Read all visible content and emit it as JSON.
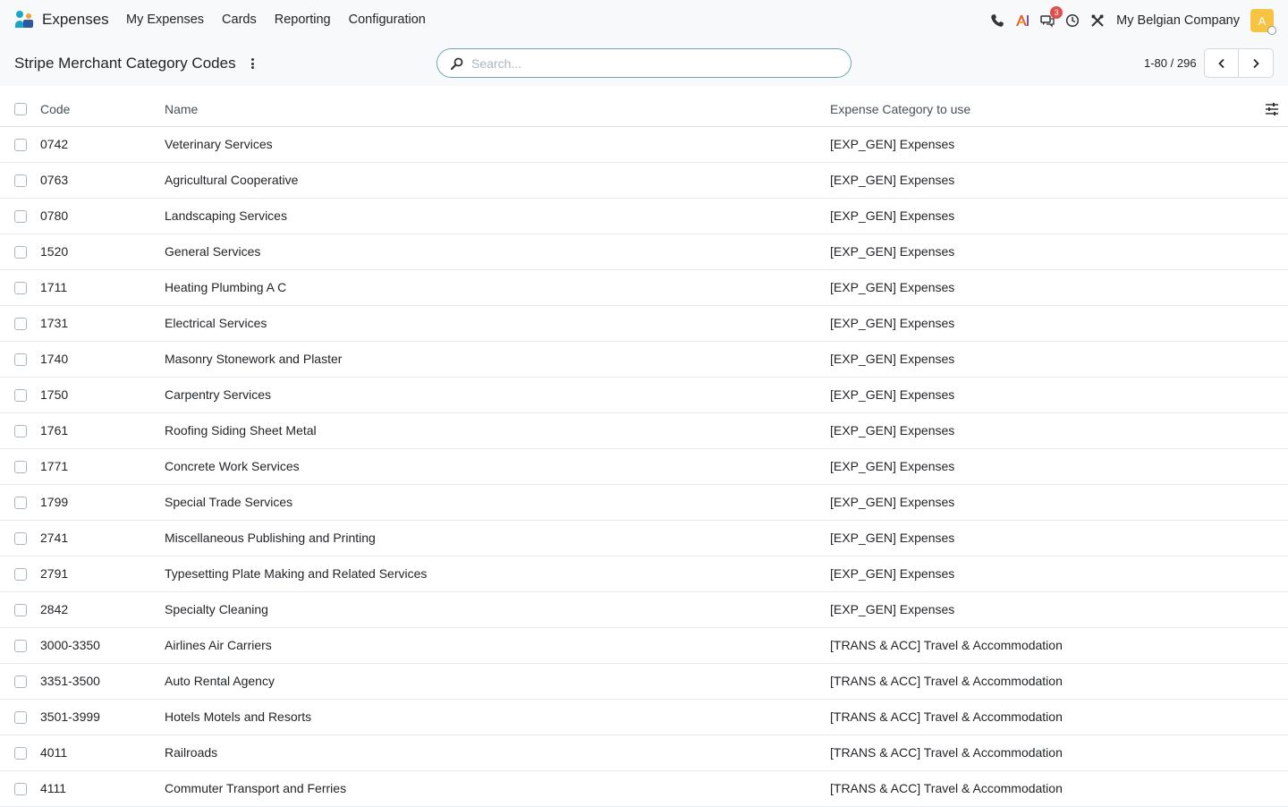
{
  "navbar": {
    "app_name": "Expenses",
    "menu": [
      "My Expenses",
      "Cards",
      "Reporting",
      "Configuration"
    ],
    "messages_badge": "3",
    "company": "My Belgian Company",
    "avatar_initial": "A"
  },
  "control": {
    "title": "Stripe Merchant Category Codes",
    "search_placeholder": "Search...",
    "pager_value": "1-80 / 296"
  },
  "table": {
    "headers": {
      "code": "Code",
      "name": "Name",
      "category": "Expense Category to use"
    },
    "rows": [
      {
        "code": "0742",
        "name": "Veterinary Services",
        "category": "[EXP_GEN] Expenses"
      },
      {
        "code": "0763",
        "name": "Agricultural Cooperative",
        "category": "[EXP_GEN] Expenses"
      },
      {
        "code": "0780",
        "name": "Landscaping Services",
        "category": "[EXP_GEN] Expenses"
      },
      {
        "code": "1520",
        "name": "General Services",
        "category": "[EXP_GEN] Expenses"
      },
      {
        "code": "1711",
        "name": "Heating Plumbing A C",
        "category": "[EXP_GEN] Expenses"
      },
      {
        "code": "1731",
        "name": "Electrical Services",
        "category": "[EXP_GEN] Expenses"
      },
      {
        "code": "1740",
        "name": "Masonry Stonework and Plaster",
        "category": "[EXP_GEN] Expenses"
      },
      {
        "code": "1750",
        "name": "Carpentry Services",
        "category": "[EXP_GEN] Expenses"
      },
      {
        "code": "1761",
        "name": "Roofing Siding Sheet Metal",
        "category": "[EXP_GEN] Expenses"
      },
      {
        "code": "1771",
        "name": "Concrete Work Services",
        "category": "[EXP_GEN] Expenses"
      },
      {
        "code": "1799",
        "name": "Special Trade Services",
        "category": "[EXP_GEN] Expenses"
      },
      {
        "code": "2741",
        "name": "Miscellaneous Publishing and Printing",
        "category": "[EXP_GEN] Expenses"
      },
      {
        "code": "2791",
        "name": "Typesetting Plate Making and Related Services",
        "category": "[EXP_GEN] Expenses"
      },
      {
        "code": "2842",
        "name": "Specialty Cleaning",
        "category": "[EXP_GEN] Expenses"
      },
      {
        "code": "3000-3350",
        "name": "Airlines Air Carriers",
        "category": "[TRANS & ACC] Travel & Accommodation"
      },
      {
        "code": "3351-3500",
        "name": "Auto Rental Agency",
        "category": "[TRANS & ACC] Travel & Accommodation"
      },
      {
        "code": "3501-3999",
        "name": "Hotels Motels and Resorts",
        "category": "[TRANS & ACC] Travel & Accommodation"
      },
      {
        "code": "4011",
        "name": "Railroads",
        "category": "[TRANS & ACC] Travel & Accommodation"
      },
      {
        "code": "4111",
        "name": "Commuter Transport and Ferries",
        "category": "[TRANS & ACC] Travel & Accommodation"
      }
    ]
  }
}
